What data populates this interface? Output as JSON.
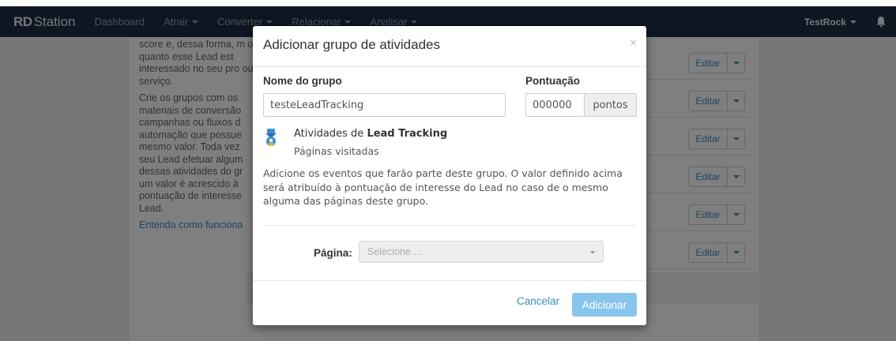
{
  "navbar": {
    "brand_bold": "RD",
    "brand_rest": "Station",
    "items": [
      {
        "label": "Dashboard",
        "has_caret": false
      },
      {
        "label": "Atrair",
        "has_caret": true
      },
      {
        "label": "Converter",
        "has_caret": true
      },
      {
        "label": "Relacionar",
        "has_caret": true
      },
      {
        "label": "Analisar",
        "has_caret": true
      }
    ],
    "account": "TestRock",
    "bell_icon": "bell-icon"
  },
  "background": {
    "paragraphs": [
      "score e, dessa forma, m o quanto esse Lead est interessado no seu pro ou serviço.",
      "Crie os grupos com os materiais de conversão campanhas ou fluxos d automação que possue mesmo valor. Toda vez seu Lead efetuar algum dessas atividades do gr um valor é acrescido à pontuação de interesse Lead."
    ],
    "link": "Entenda como funciona",
    "edit_label": "Editar",
    "rows": 6
  },
  "modal": {
    "title": "Adicionar grupo de atividades",
    "close": "×",
    "group_name_label": "Nome do grupo",
    "group_name_value": "testeLeadTracking",
    "score_label": "Pontuação",
    "score_value": "000000",
    "score_addon": "pontos",
    "activity_prefix": "Atividades de ",
    "activity_bold": "Lead Tracking",
    "activity_sub": "Páginas visitadas",
    "description": "Adicione os eventos que farão parte deste grupo. O valor definido acima será atribuído à pontuação de interesse do Lead no caso de o mesmo alguma das páginas deste grupo.",
    "page_label": "Página:",
    "page_placeholder": "Selecione ...",
    "cancel": "Cancelar",
    "add": "Adicionar"
  },
  "colors": {
    "navbar": "#1f2c44",
    "link": "#3c8dbc",
    "primary_disabled": "#88c5ec"
  }
}
